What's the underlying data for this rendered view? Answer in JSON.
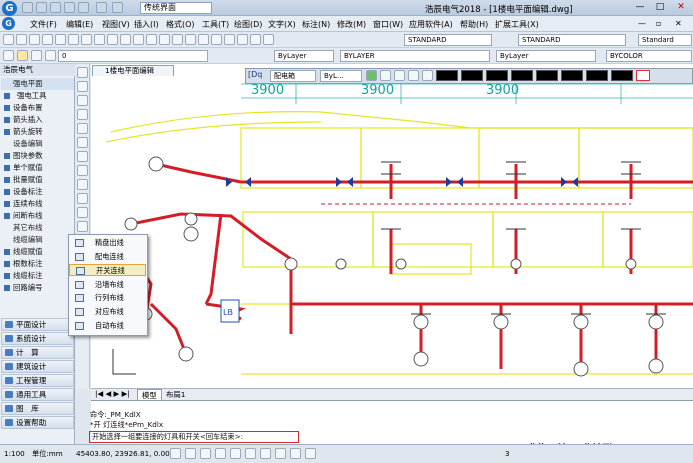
{
  "app": {
    "logo": "G",
    "title": "浩辰电气2018 - [1楼电平面编辑.dwg]",
    "workspace": "传统界面",
    "win_buttons": [
      "—",
      "□",
      "✕"
    ]
  },
  "menu": [
    "文件(F)",
    "编辑(E)",
    "视图(V)",
    "插入(I)",
    "格式(O)",
    "工具(T)",
    "绘图(D)",
    "文字(X)",
    "标注(N)",
    "修改(M)",
    "窗口(W)",
    "应用软件(A)",
    "帮助(H)",
    "扩展工具(X)"
  ],
  "toolbar": {
    "style1": "STANDARD",
    "style2": "STANDARD",
    "style3": "Standard",
    "layer": "0",
    "color": "ByLayer",
    "linetype": "BYLAYER",
    "lineweight": "ByLayer",
    "plotstyle": "BYCOLOR"
  },
  "panel": {
    "title": "浩辰电气",
    "top": [
      "强电平面",
      "强电工具",
      "设备布置",
      "箭头插入",
      "箭头旋转",
      "设备编辑",
      "图块参数",
      "单个赋值",
      "批量赋值",
      "设备标注",
      "连续布线",
      "间断布线",
      "其它布线",
      "线缆编辑",
      "线缆赋值",
      "根数标注",
      "线缆标注",
      "回路编号"
    ],
    "cats": [
      "平面设计",
      "系统设计",
      "计　算",
      "建筑设计",
      "工程管理",
      "通用工具",
      "图　库",
      "设置帮助"
    ]
  },
  "doc_tab": "1楼电平面编辑",
  "float_toolbar": {
    "label": "配电箱",
    "layer": "ByL..."
  },
  "context_menu": [
    "精盘出线",
    "配电连线",
    "开关连线",
    "沿墙布线",
    "行列布线",
    "对应布线",
    "自动布线"
  ],
  "canvas": {
    "dims": [
      "3900",
      "3900",
      "3900"
    ],
    "label": "LB",
    "tabs": [
      "模型",
      "布局1"
    ]
  },
  "command": {
    "lines": [
      "命令:_PM_KdlX",
      "*开 灯连线*ePm_Kdlx"
    ],
    "prompt": "开始选择一组要连接的灯具和开关<回车结束>:"
  },
  "watermark": "化海川流-工业社群@HCBBS",
  "status": {
    "scale": "1:100",
    "units": "单位:mm",
    "coords": "45403.80, 23926.81, 0.00",
    "page": "3"
  }
}
